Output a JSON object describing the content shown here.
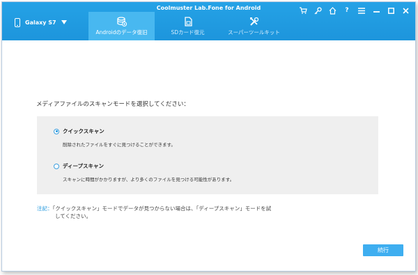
{
  "window": {
    "title": "Coolmuster Lab.Fone for Android"
  },
  "device": {
    "name": "Galaxy S7",
    "icon": "phone-icon"
  },
  "tabs": [
    {
      "label": "Androidのデータ復旧",
      "icon": "database-restore-icon",
      "active": true
    },
    {
      "label": "SDカード復元",
      "icon": "sd-card-icon",
      "active": false
    },
    {
      "label": "スーパーツールキット",
      "icon": "tools-icon",
      "active": false
    }
  ],
  "controls": {
    "cart": "cart-icon",
    "key": "key-icon",
    "home": "home-icon",
    "help": "help-icon",
    "menu": "menu-icon",
    "minimize": "minimize-icon",
    "maximize": "maximize-icon",
    "close": "close-icon"
  },
  "main": {
    "prompt": "メディアファイルのスキャンモードを選択してください：",
    "options": [
      {
        "title": "クイックスキャン",
        "desc": "削除されたファイルをすぐに見つけることができます。",
        "checked": true
      },
      {
        "title": "ディープスキャン",
        "desc": "スキャンに時間がかかりますが、より多くのファイルを見つける可能性があります。",
        "checked": false
      }
    ],
    "note_label": "注記：",
    "note_line1": "「クイックスキャン」モードでデータが見つからない場合は、「ディープスキャン」モードを試",
    "note_line2": "してください。",
    "continue_label": "続行"
  },
  "colors": {
    "accent": "#1d95dc",
    "tab_active": "#48b8f0",
    "panel": "#efefef"
  }
}
